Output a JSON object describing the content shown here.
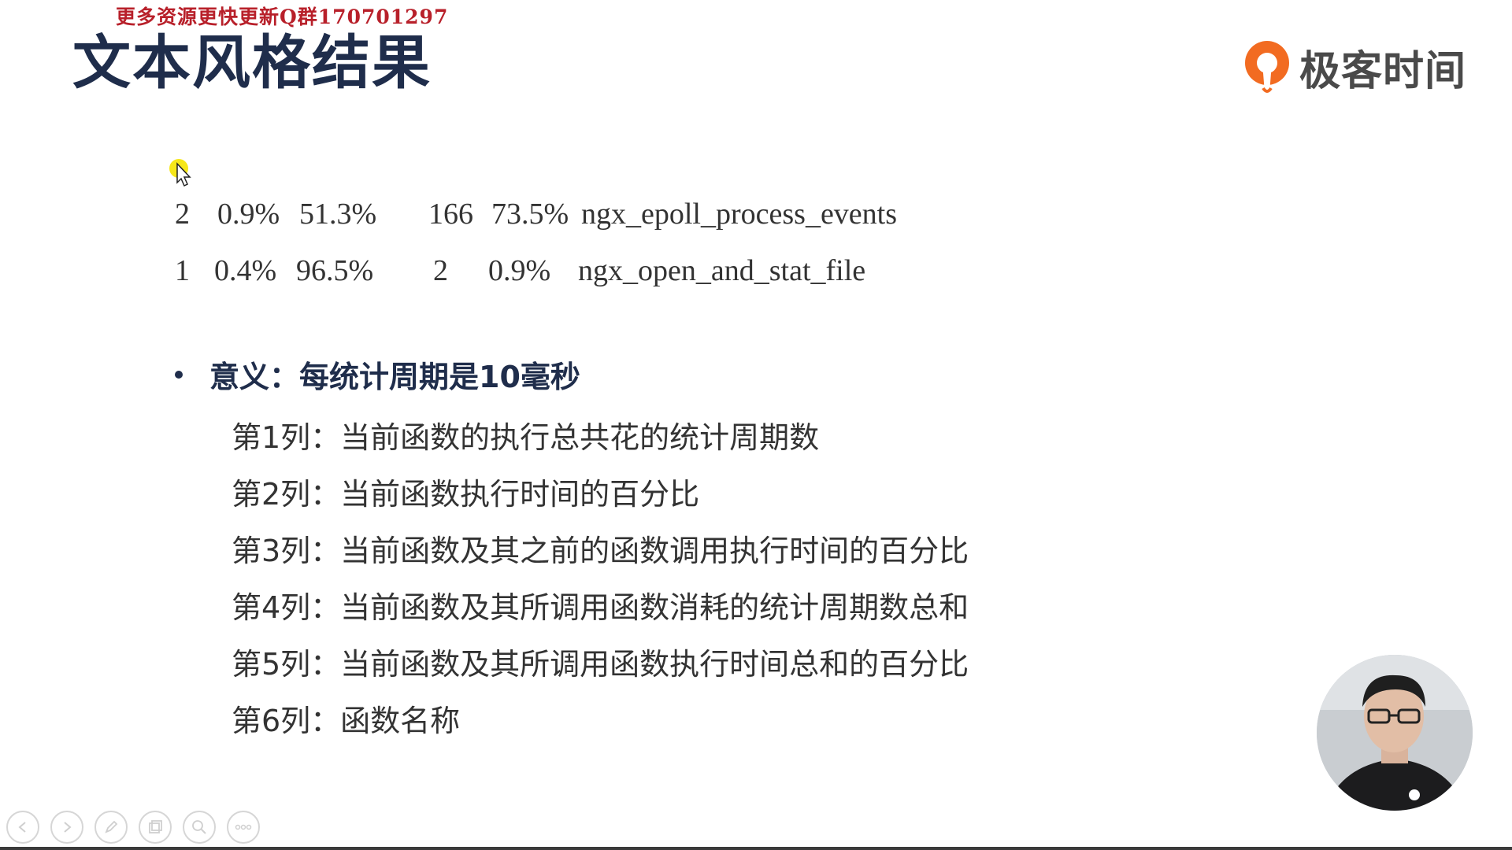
{
  "watermark": "更多资源更快更新Q群170701297",
  "title": "文本风格结果",
  "brand": {
    "name": "极客时间",
    "icon": "geektime-logo-icon",
    "color": "#f26b21"
  },
  "data_rows": [
    [
      "2",
      "0.9%",
      "51.3%",
      "166",
      "73.5%",
      "ngx_epoll_process_events"
    ],
    [
      "1",
      "0.4%",
      "96.5%",
      "2",
      "0.9%",
      "ngx_open_and_stat_file"
    ]
  ],
  "bullet": {
    "heading": "意义：每统计周期是10毫秒"
  },
  "columns": [
    "第1列：当前函数的执行总共花的统计周期数",
    "第2列：当前函数执行时间的百分比",
    "第3列：当前函数及其之前的函数调用执行时间的百分比",
    "第4列：当前函数及其所调用函数消耗的统计周期数总和",
    "第5列：当前函数及其所调用函数执行时间总和的百分比",
    "第6列：函数名称"
  ],
  "toolbar": {
    "buttons": [
      "previous-icon",
      "next-icon",
      "pen-icon",
      "slides-icon",
      "zoom-icon",
      "more-icon"
    ]
  },
  "colors": {
    "title": "#1f2d4b",
    "watermark": "#b8202a",
    "cursor_highlight": "#f5e400"
  }
}
